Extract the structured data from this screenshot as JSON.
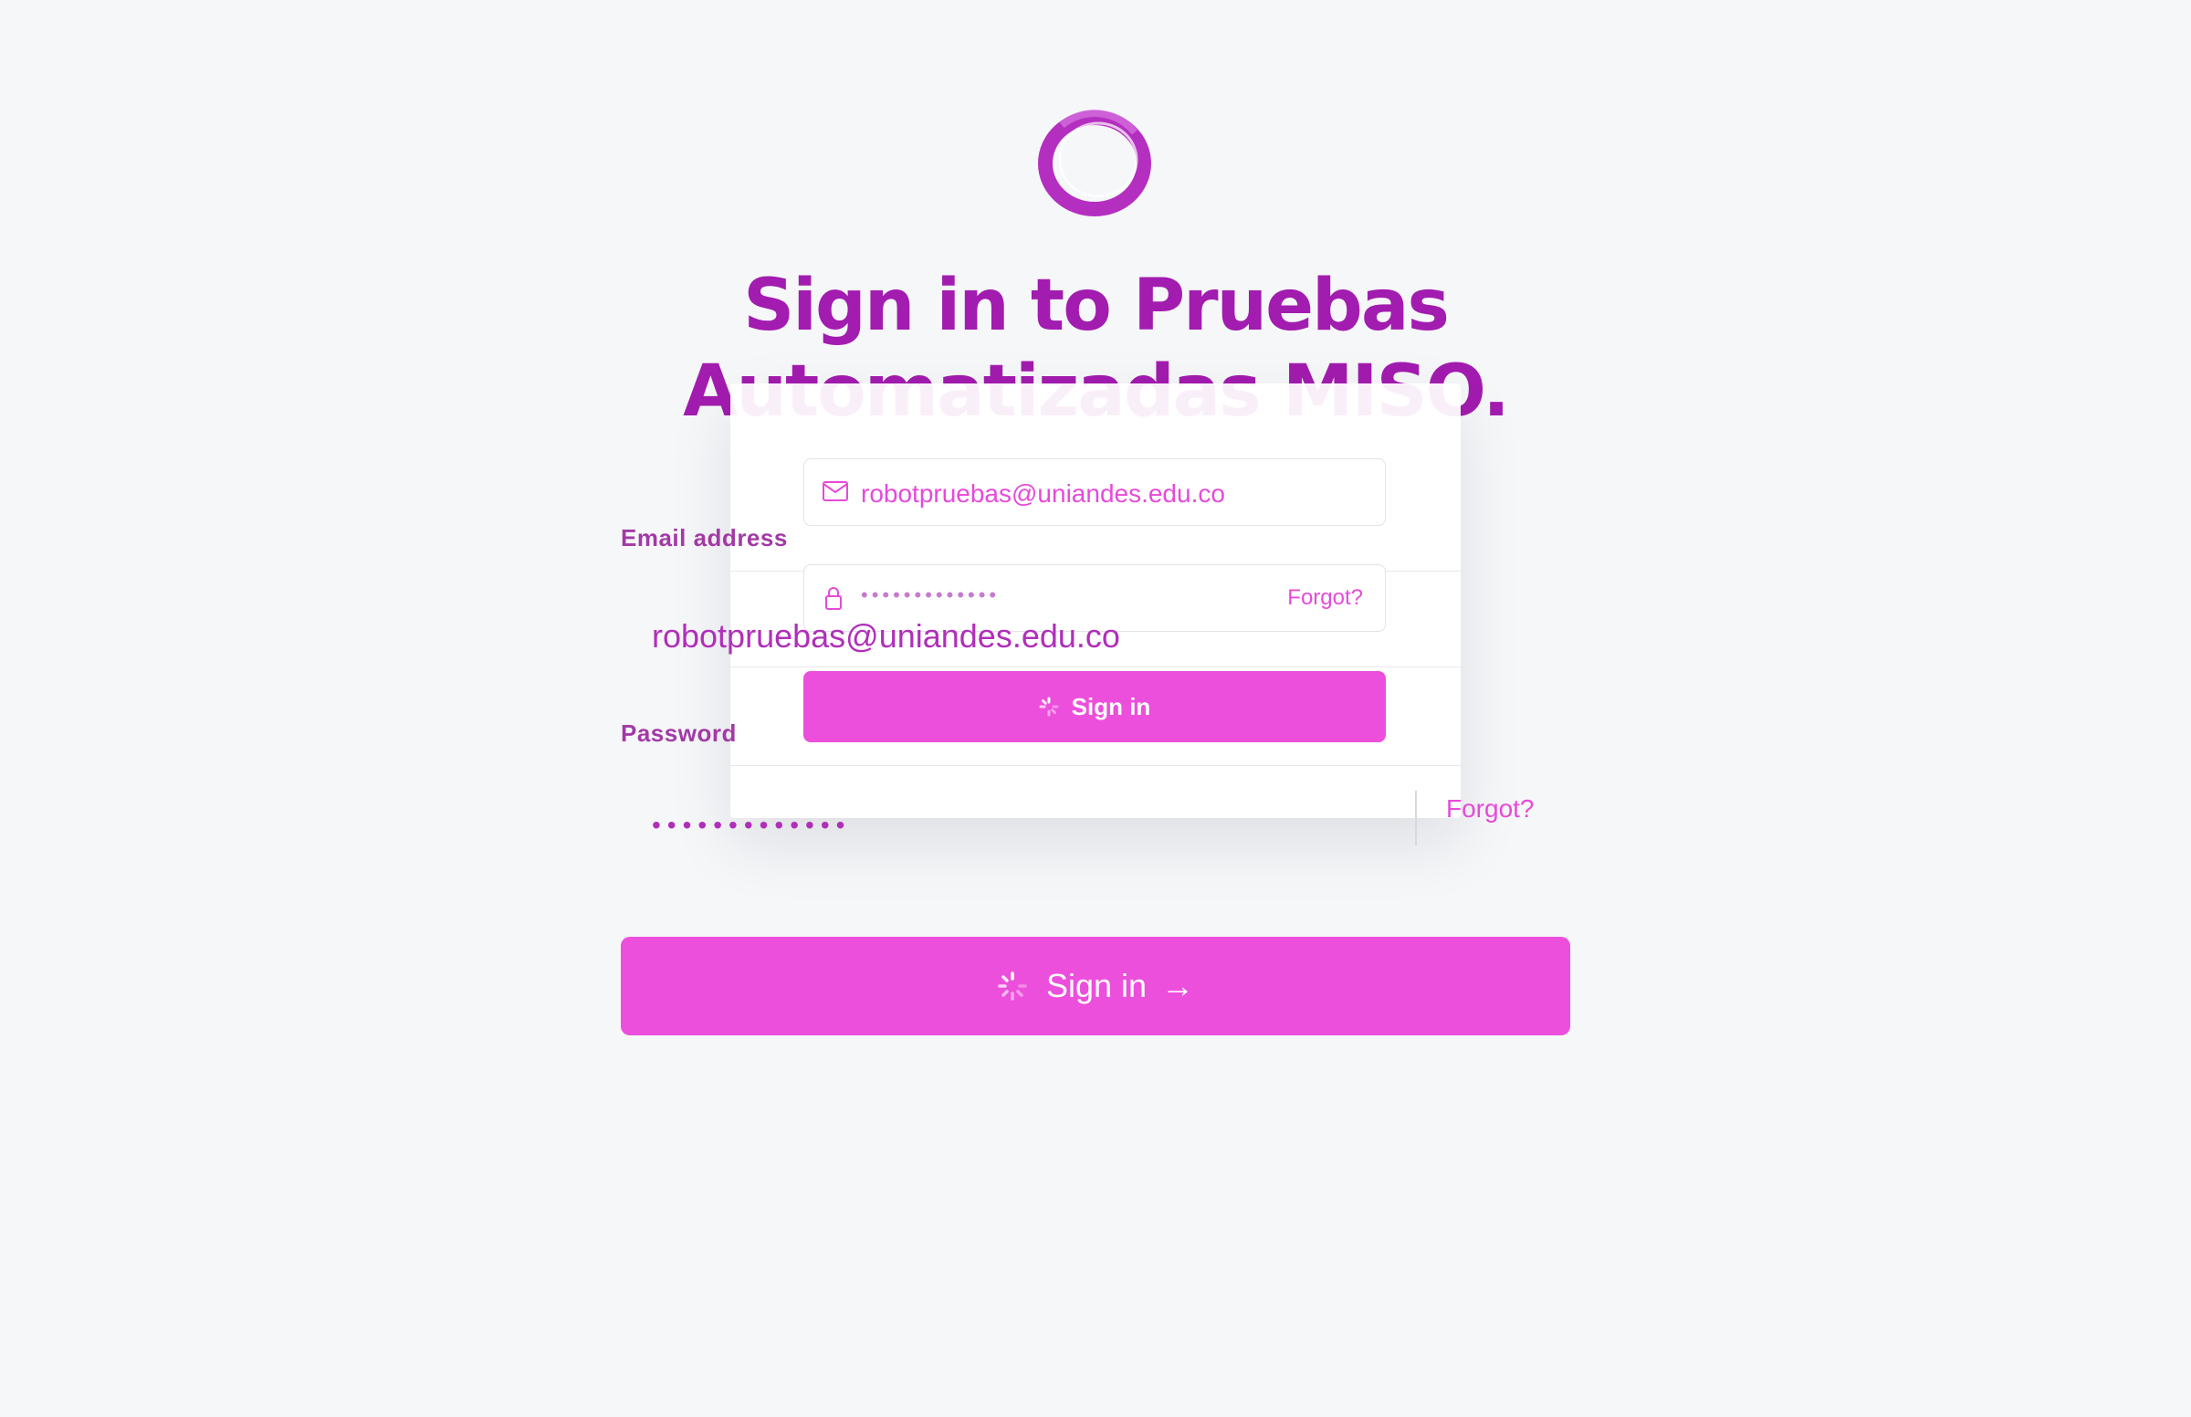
{
  "title": "Sign in to Pruebas Automatizadas MISO.",
  "ghost": {
    "email_value": "robotpruebas@uniandes.edu.co",
    "password_dots": "•••••••••••••",
    "forgot_label": "Forgot?",
    "signin_label": "Sign in"
  },
  "form": {
    "email_label": "Email address",
    "email_value": "robotpruebas@uniandes.edu.co",
    "password_label": "Password",
    "password_dots": "•••••••••••••",
    "forgot_label": "Forgot?",
    "signin_label": "Sign in",
    "signin_arrow": "→"
  },
  "colors": {
    "accent": "#ec4fdb",
    "title": "#a21caf",
    "label": "#a23aa6",
    "background": "#f6f7f9"
  }
}
